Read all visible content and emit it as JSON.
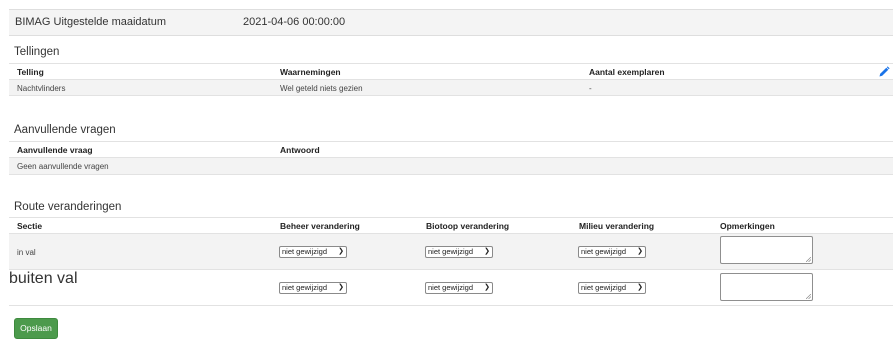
{
  "header": {
    "label": "BIMAG Uitgestelde maaidatum",
    "datetime": "2021-04-06 00:00:00"
  },
  "tellingen": {
    "title": "Tellingen",
    "columns": [
      "Telling",
      "Waarnemingen",
      "Aantal exemplaren"
    ],
    "rows": [
      {
        "telling": "Nachtvlinders",
        "waarnemingen": "Wel geteld niets gezien",
        "aantal": "-"
      }
    ],
    "edit_icon": "pencil-icon"
  },
  "aanvullend": {
    "title": "Aanvullende vragen",
    "columns": [
      "Aanvullende vraag",
      "Antwoord"
    ],
    "empty_text": "Geen aanvullende vragen"
  },
  "route": {
    "title": "Route veranderingen",
    "columns": [
      "Sectie",
      "Beheer verandering",
      "Biotoop verandering",
      "Milieu verandering",
      "Opmerkingen"
    ],
    "rows": [
      {
        "sectie": "in val",
        "beheer": "niet gewijzigd",
        "biotoop": "niet gewijzigd",
        "milieu": "niet gewijzigd",
        "opmerkingen": ""
      },
      {
        "sectie": "buiten val",
        "beheer": "niet gewijzigd",
        "biotoop": "niet gewijzigd",
        "milieu": "niet gewijzigd",
        "opmerkingen": ""
      }
    ]
  },
  "save_label": "Opslaan",
  "colors": {
    "save_button": "#4c9a4c",
    "edit_icon": "#1a73e8"
  }
}
